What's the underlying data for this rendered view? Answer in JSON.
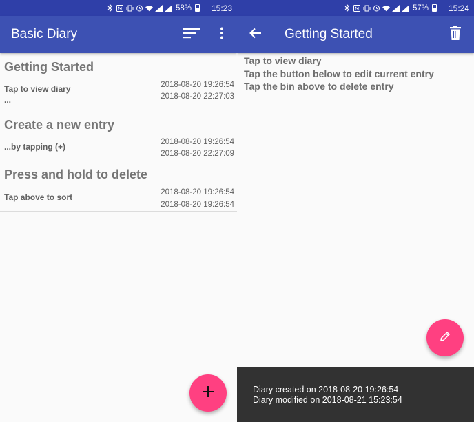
{
  "left": {
    "status": {
      "battery": "58%",
      "time": "15:23",
      "battery_level": 0.58
    },
    "appbar": {
      "title": "Basic Diary",
      "sort_icon": "sort-icon",
      "menu_icon": "more-vert-icon"
    },
    "entries": [
      {
        "title": "Getting Started",
        "preview": "Tap to view diary",
        "preview2": "...",
        "created": "2018-08-20 19:26:54",
        "modified": "2018-08-20 22:27:03"
      },
      {
        "title": "Create a new entry",
        "preview": "...by tapping (+)",
        "preview2": "",
        "created": "2018-08-20 19:26:54",
        "modified": "2018-08-20 22:27:09"
      },
      {
        "title": "Press and hold to delete",
        "preview": "Tap above to sort",
        "preview2": "",
        "created": "2018-08-20 19:26:54",
        "modified": "2018-08-20 19:26:54"
      }
    ],
    "fab_icon": "plus-icon",
    "accent": "#ff4081",
    "primary": "#3d51b3"
  },
  "right": {
    "status": {
      "battery": "57%",
      "time": "15:24",
      "battery_level": 0.57
    },
    "appbar": {
      "title": "Getting Started",
      "back_icon": "arrow-back-icon",
      "delete_icon": "trash-icon"
    },
    "content": [
      "Tap to view diary",
      "Tap the button below to edit current entry",
      "Tap the bin above to delete entry"
    ],
    "fab_icon": "pencil-icon",
    "snackbar": {
      "created": "Diary created on 2018-08-20 19:26:54",
      "modified": "Diary modified on 2018-08-21 15:23:54"
    }
  }
}
